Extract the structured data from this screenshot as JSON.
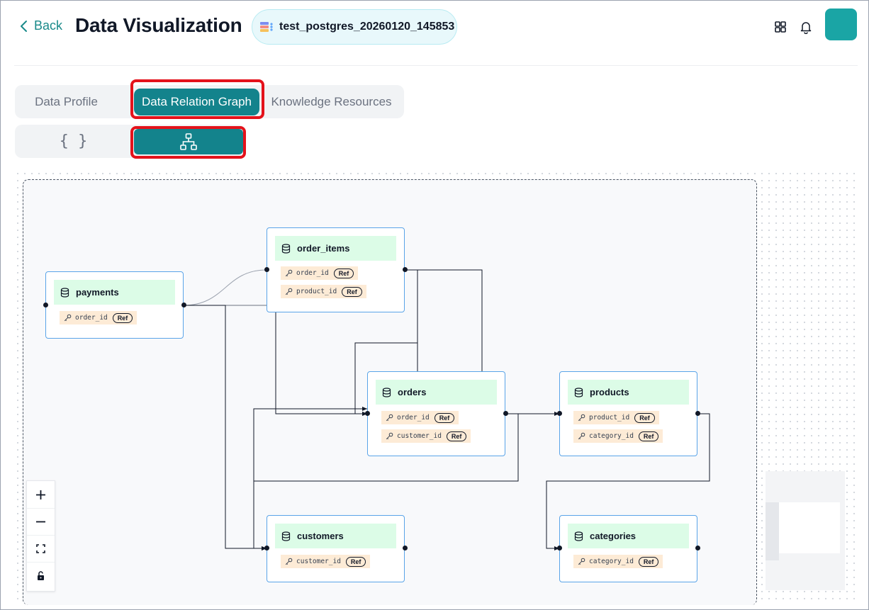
{
  "header": {
    "back_label": "Back",
    "title": "Data Visualization",
    "database_name": "test_postgres_20260120_145853",
    "icons": [
      "chevron-left-icon",
      "database-icon",
      "grid-icon",
      "bell-icon"
    ],
    "avatar_color": "#1aa5a5"
  },
  "tabs": {
    "items": [
      {
        "label": "Data Profile",
        "active": false
      },
      {
        "label": "Data Relation Graph",
        "active": true
      },
      {
        "label": "Knowledge Resources",
        "active": false
      }
    ]
  },
  "view_toggle": {
    "json_label": "{ }",
    "active": "graph"
  },
  "graph": {
    "ref_label": "Ref",
    "nodes": [
      {
        "name": "order_items",
        "fields": [
          "order_id",
          "product_id"
        ]
      },
      {
        "name": "payments",
        "fields": [
          "order_id"
        ]
      },
      {
        "name": "orders",
        "fields": [
          "order_id",
          "customer_id"
        ]
      },
      {
        "name": "products",
        "fields": [
          "product_id",
          "category_id"
        ]
      },
      {
        "name": "customers",
        "fields": [
          "customer_id"
        ]
      },
      {
        "name": "categories",
        "fields": [
          "category_id"
        ]
      }
    ]
  },
  "controls": [
    "zoom-in-icon",
    "zoom-out-icon",
    "fit-view-icon",
    "lock-icon"
  ],
  "colors": {
    "accent": "#13838c",
    "highlight": "#e4121b",
    "node_header": "#dcfce7",
    "field_bg": "#fdebd6",
    "node_border": "#5aa4e8"
  }
}
